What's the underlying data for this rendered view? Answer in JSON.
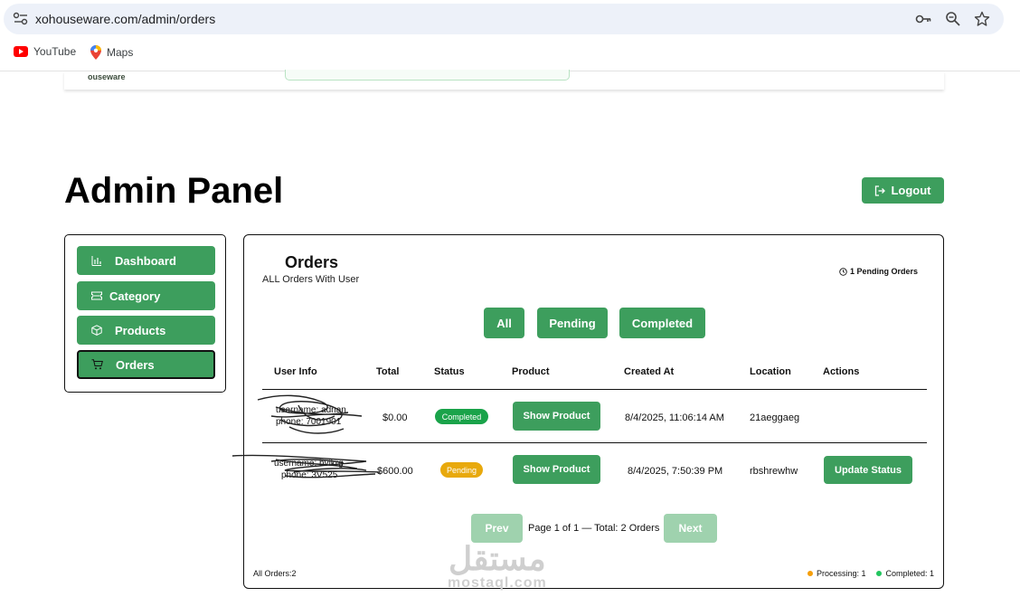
{
  "browser": {
    "url": "xohouseware.com/admin/orders",
    "bookmarks": [
      "YouTube",
      "Maps"
    ]
  },
  "site": {
    "logo_text": "ouseware"
  },
  "page": {
    "title": "Admin Panel",
    "logout_label": "Logout"
  },
  "sidebar": {
    "items": [
      {
        "label": "Dashboard",
        "icon": "chart-icon",
        "active": false
      },
      {
        "label": "Category",
        "icon": "ticket-icon",
        "active": false
      },
      {
        "label": "Products",
        "icon": "box-icon",
        "active": false
      },
      {
        "label": "Orders",
        "icon": "cart-icon",
        "active": true
      }
    ]
  },
  "orders": {
    "title": "Orders",
    "subtitle": "ALL Orders With User",
    "pending_count": "1 Pending Orders",
    "filters": [
      "All",
      "Pending",
      "Completed"
    ],
    "columns": [
      "User Info",
      "Total",
      "Status",
      "Product",
      "Created At",
      "Location",
      "Actions"
    ],
    "rows": [
      {
        "user_line1": "username: adnan",
        "user_line2": "phone: 7001901",
        "total": "$0.00",
        "status": "Completed",
        "product_button": "Show Product",
        "created_at": "8/4/2025, 11:06:14 AM",
        "location": "21aeggaeg",
        "action": ""
      },
      {
        "user_line1": "username: hvikrg",
        "user_line2": "phone: 3V525",
        "total": "$600.00",
        "status": "Pending",
        "product_button": "Show Product",
        "created_at": "8/4/2025, 7:50:39 PM",
        "location": "rbshrewhw",
        "action": "Update Status"
      }
    ],
    "pagination": {
      "prev": "Prev",
      "info": "Page 1 of 1 — Total: 2 Orders",
      "next": "Next"
    },
    "footer": {
      "all_orders": "All Orders:2",
      "processing": "Processing: 1",
      "completed": "Completed: 1"
    }
  },
  "watermark": {
    "arabic": "مستقل",
    "latin": "mostaql.com"
  },
  "colors": {
    "accent": "#3d9e5d",
    "accent_disabled": "#9fd2ae",
    "status_completed": "#1aa34a",
    "status_pending": "#e8a90c",
    "legend_processing": "#f59e0b",
    "legend_completed": "#22c55e"
  }
}
